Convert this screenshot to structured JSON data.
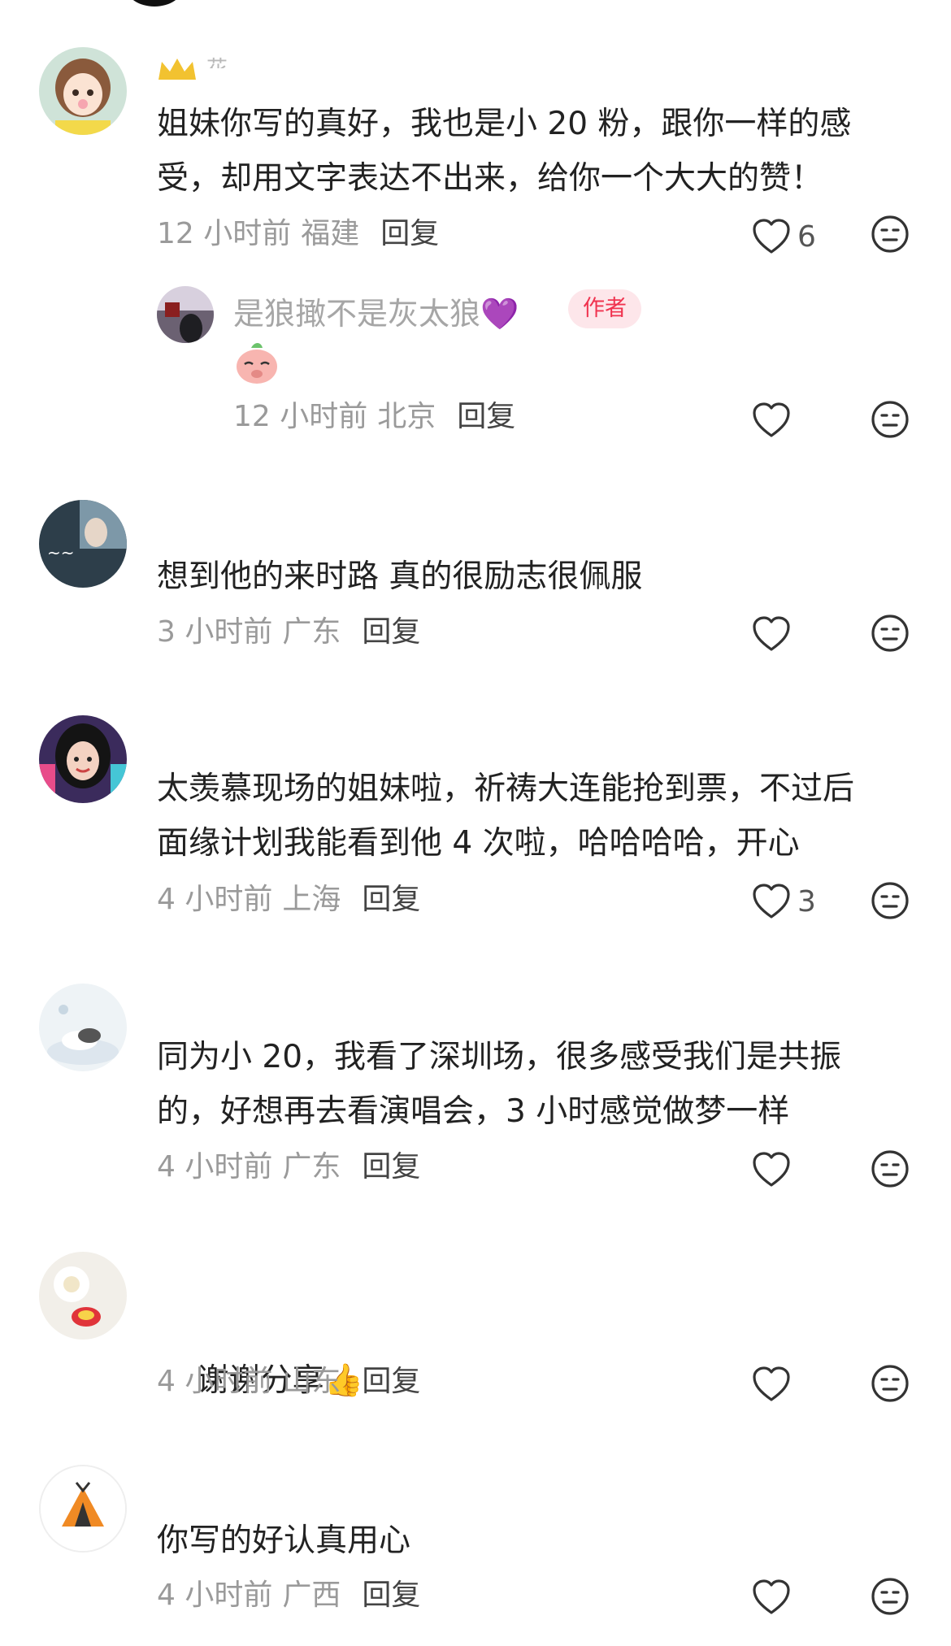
{
  "comments": [
    {
      "username": "花",
      "text": "姐妹你写的真好，我也是小 20 粉，跟你一样的感\n受，却用文字表达不出来，给你一个大大的赞！",
      "time": "12 小时前",
      "location": "福建",
      "reply": "回复",
      "likes": "6",
      "avatar_icon": "cartoon-girl-avatar",
      "badge_icon": "crown-icon",
      "sub_reply": {
        "username": "是狼撖不是灰太狼",
        "emoji": "💜",
        "badge": "作者",
        "sticker_icon": "pig-sticker-icon",
        "time": "12 小时前",
        "location": "北京",
        "reply": "回复"
      }
    },
    {
      "username": "",
      "text": "想到他的来时路 真的很励志很佩服",
      "time": "3 小时前",
      "location": "广东",
      "reply": "回复",
      "likes": "",
      "avatar_icon": "photo-avatar"
    },
    {
      "username": "",
      "text": "太羡慕现场的姐妹啦，祈祷大连能抢到票，不过后\n面缘计划我能看到他 4 次啦，哈哈哈哈，开心",
      "time": "4 小时前",
      "location": "上海",
      "reply": "回复",
      "likes": "3",
      "avatar_icon": "colorful-girl-avatar"
    },
    {
      "username": "",
      "text": "同为小 20，我看了深圳场，很多感受我们是共振\n的，好想再去看演唱会，3 小时感觉做梦一样",
      "time": "4 小时前",
      "location": "广东",
      "reply": "回复",
      "likes": "",
      "avatar_icon": "cloud-cat-avatar"
    },
    {
      "username": "",
      "text": "谢谢分享",
      "emoji": "👍",
      "time": "4 小时前",
      "location": "山东",
      "reply": "回复",
      "likes": "",
      "avatar_icon": "flower-avatar"
    },
    {
      "username": "",
      "text": "你写的好认真用心",
      "time": "4 小时前",
      "location": "广西",
      "reply": "回复",
      "likes": "",
      "avatar_icon": "tent-avatar"
    }
  ],
  "colors": {
    "text": "#222222",
    "meta": "#9a9a9a",
    "author_badge_bg": "#fde6ea",
    "author_badge_text": "#f0334f"
  }
}
